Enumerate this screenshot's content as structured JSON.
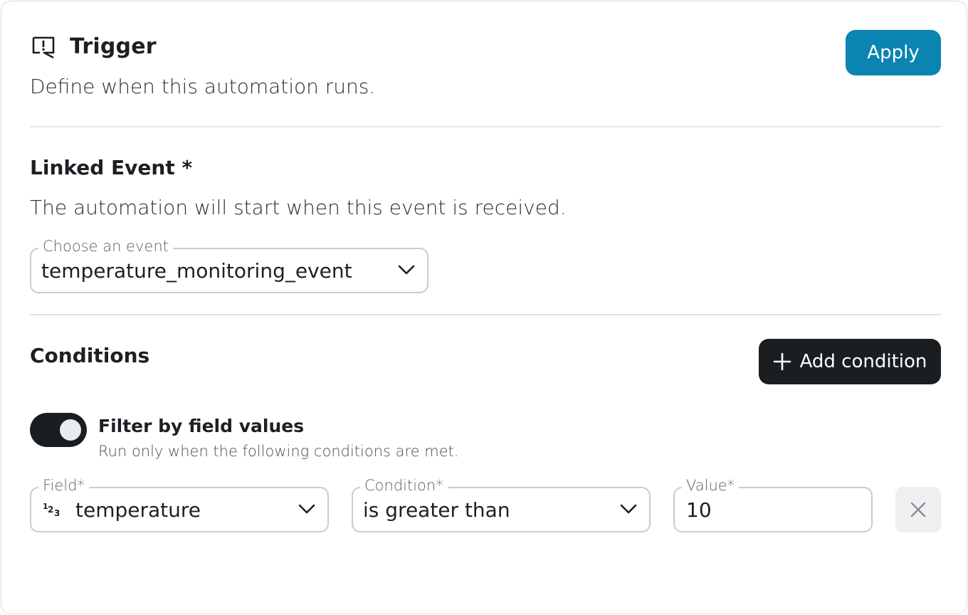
{
  "header": {
    "title": "Trigger",
    "subtitle": "Define when this automation runs.",
    "apply_label": "Apply",
    "icon": "alert-message-icon"
  },
  "linked_event": {
    "title": "Linked Event *",
    "description": "The automation will start when this event is received.",
    "select_label": "Choose an event",
    "select_value": "temperature_monitoring_event"
  },
  "conditions": {
    "title": "Conditions",
    "add_label": "Add condition",
    "filter_title": "Filter by field values",
    "filter_description": "Run only when the following conditions are met.",
    "filter_enabled": true,
    "row": {
      "field_label": "Field*",
      "field_value": "temperature",
      "field_type_icon": "numeric-type-icon",
      "condition_label": "Condition*",
      "condition_value": "is greater than",
      "value_label": "Value*",
      "value_value": "10"
    }
  },
  "colors": {
    "accent": "#0b84b1",
    "dark_button": "#1b1e21"
  }
}
